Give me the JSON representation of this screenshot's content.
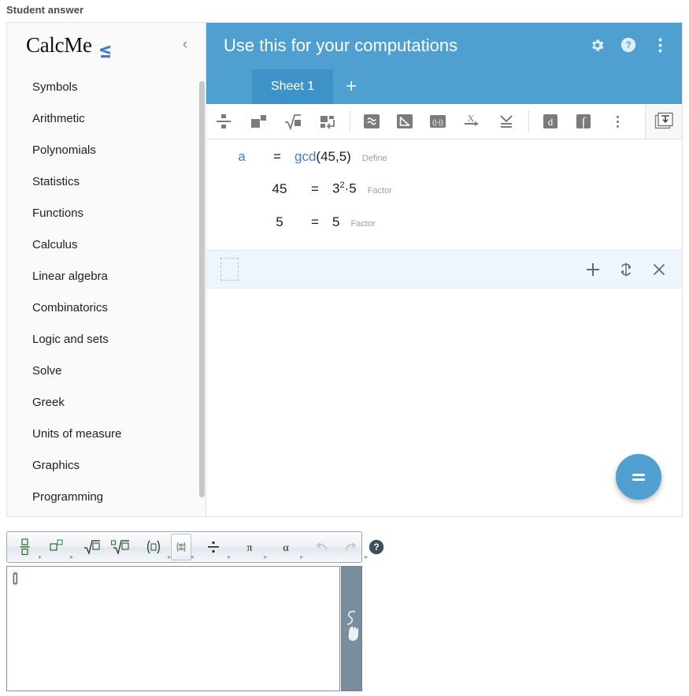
{
  "page": {
    "label": "Student answer"
  },
  "sidebar": {
    "brand": "CalcMe",
    "brand_mark": "less-than-or-equal-logo-icon",
    "collapse_icon": "‹",
    "items": [
      {
        "label": "Symbols"
      },
      {
        "label": "Arithmetic"
      },
      {
        "label": "Polynomials"
      },
      {
        "label": "Statistics"
      },
      {
        "label": "Functions"
      },
      {
        "label": "Calculus"
      },
      {
        "label": "Linear algebra"
      },
      {
        "label": "Combinatorics"
      },
      {
        "label": "Logic and sets"
      },
      {
        "label": "Solve"
      },
      {
        "label": "Greek"
      },
      {
        "label": "Units of measure"
      },
      {
        "label": "Graphics"
      },
      {
        "label": "Programming"
      }
    ]
  },
  "header": {
    "title": "Use this for your computations",
    "background_color": "#4f9fd0",
    "actions": [
      {
        "name": "settings-icon",
        "title": "Settings"
      },
      {
        "name": "help-icon",
        "title": "Help"
      },
      {
        "name": "more-vertical-icon",
        "title": "More options"
      }
    ],
    "tabs": [
      {
        "label": "Sheet 1",
        "active": true
      }
    ],
    "add_tab_label": "+"
  },
  "math_toolbar": {
    "groups": [
      [
        {
          "name": "fraction-icon",
          "title": "Fraction"
        },
        {
          "name": "power-icon",
          "title": "Power"
        },
        {
          "name": "square-root-icon",
          "title": "Square root"
        },
        {
          "name": "newline-icon",
          "title": "New line"
        }
      ],
      [
        {
          "name": "approximate-icon",
          "title": "Approximate"
        },
        {
          "name": "simplify-icon",
          "title": "Simplify"
        },
        {
          "name": "evaluate-icon",
          "title": "Evaluate"
        },
        {
          "name": "solve-for-x-icon",
          "title": "Solve"
        },
        {
          "name": "check-list-icon",
          "title": "Check"
        }
      ],
      [
        {
          "name": "derivative-icon",
          "title": "Derivative"
        },
        {
          "name": "integral-icon",
          "title": "Integral"
        },
        {
          "name": "more-vertical-icon",
          "title": "More"
        }
      ]
    ],
    "last_button": {
      "name": "keyboard-insert-icon",
      "title": "Insert",
      "active": true
    }
  },
  "worksheet": {
    "lines": [
      {
        "lhs": "a",
        "lhs_style": "variable",
        "eq": "=",
        "rhs_fn": "gcd",
        "rhs_rest": "(45,5)",
        "tag": "Define"
      },
      {
        "lhs": "45",
        "lhs_style": "plain",
        "eq": "=",
        "rhs_base": "3",
        "rhs_exp": "2",
        "rhs_tail": "·5",
        "tag": "Factor"
      },
      {
        "lhs": "5",
        "lhs_style": "plain",
        "eq": "=",
        "rhs_plain": "5",
        "tag": "Factor"
      }
    ],
    "active_row": {
      "placeholder_slot": "empty-input-slot",
      "actions": [
        {
          "name": "add-row-icon",
          "glyph": "+",
          "title": "Add"
        },
        {
          "name": "recalculate-icon",
          "glyph": "↻",
          "title": "Recalculate"
        },
        {
          "name": "delete-row-icon",
          "glyph": "×",
          "title": "Delete"
        }
      ]
    },
    "fab": {
      "name": "equals-button",
      "glyph": "=",
      "color": "#4f9fd0"
    }
  },
  "mini_editor": {
    "buttons": [
      {
        "name": "fraction-icon",
        "caret": true
      },
      {
        "name": "superscript-icon",
        "caret": true
      },
      {
        "name": "square-root-icon",
        "caret": false
      },
      {
        "name": "nth-root-icon",
        "caret": false
      },
      {
        "name": "parentheses-icon",
        "caret": true
      },
      {
        "name": "matrix-icon",
        "caret": true,
        "selected": true
      },
      {
        "name": "division-icon",
        "caret": true
      },
      {
        "name": "pi-symbol-icon",
        "caret": true
      },
      {
        "name": "greek-alpha-icon",
        "caret": true
      },
      {
        "name": "undo-icon",
        "caret": false,
        "disabled": true
      },
      {
        "name": "redo-icon",
        "caret": true,
        "disabled": true
      }
    ],
    "help": {
      "name": "help-icon",
      "title": "Help"
    },
    "canvas": {
      "name": "math-input-canvas",
      "value": "",
      "cursor": "empty-box-cursor"
    },
    "hand_panel": {
      "name": "handwriting-input-icon",
      "title": "Handwriting"
    }
  }
}
